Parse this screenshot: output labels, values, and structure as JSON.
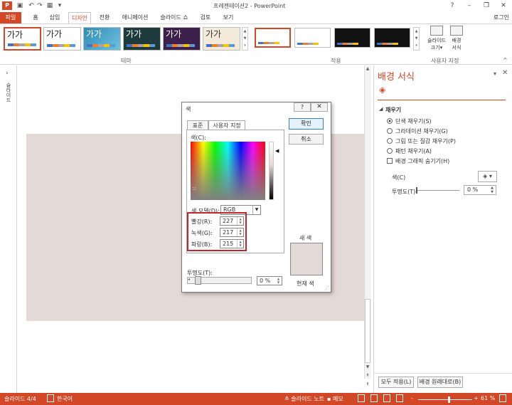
{
  "app": {
    "window_title": "프레젠테이션2 - PowerPoint",
    "logo": "P",
    "user": "로그인"
  },
  "quick_access": [
    "save-icon",
    "undo-icon",
    "redo-icon",
    "start-from-beginning-icon",
    "customize-icon"
  ],
  "window_controls": {
    "help": "?",
    "minimize": "–",
    "restore": "❐",
    "close": "✕"
  },
  "tabs": [
    "파일",
    "홈",
    "삽입",
    "디자인",
    "전환",
    "애니메이션",
    "슬라이드 쇼",
    "검토",
    "보기"
  ],
  "ribbon": {
    "theme_sample": "가가",
    "groups": {
      "themes": "테마",
      "variants": "적용",
      "customize": "사용자 지정"
    },
    "slide_size": "슬라이드\n크기",
    "slide_size_caret": "▾",
    "background_format": "배경\n서식",
    "gallery_scroll": [
      "▲",
      "▼",
      "▾"
    ],
    "collapse": "^"
  },
  "left_pane": {
    "label": "슬라이드",
    "expand": "›"
  },
  "scrollbar": {
    "up": "▲",
    "down": "▼",
    "prev": "⇞",
    "next": "⇟"
  },
  "format_pane": {
    "title": "배경 서식",
    "dropdown": "▾",
    "close": "✕",
    "section_caret": "◢",
    "section": "채우기",
    "options": [
      {
        "label": "단색 채우기(S)",
        "checked": true
      },
      {
        "label": "그라데이션 채우기(G)",
        "checked": false
      },
      {
        "label": "그림 또는 질감 채우기(P)",
        "checked": false
      },
      {
        "label": "패턴 채우기(A)",
        "checked": false
      }
    ],
    "hide_graphics": "배경 그래픽 숨기기(H)",
    "color_label": "색(C)",
    "color_button": "◈ ▾",
    "transparency_label": "투명도(T)",
    "transparency_value": "0 %",
    "transparency": 0,
    "apply_all": "모두 적용(L)",
    "reset": "배경 원래대로(B)"
  },
  "dialog": {
    "title": "색",
    "help": "?",
    "close": "✕",
    "tabs": [
      "표준",
      "사용자 지정"
    ],
    "colors_label": "색(C):",
    "model_label": "색 모델(D):",
    "model_value": "RGB",
    "model_arrow": "▼",
    "spectrum_cursor": "⁙",
    "luminance_arrow": "◀",
    "channels": [
      {
        "label": "빨강(R):",
        "value": "227"
      },
      {
        "label": "녹색(G):",
        "value": "217"
      },
      {
        "label": "파랑(B):",
        "value": "215"
      }
    ],
    "spin": "▲\n▼",
    "ok": "확인",
    "cancel": "취소",
    "new_label": "새 색",
    "current_label": "현재 색",
    "transparency_label": "투명도(T):",
    "transparency_value": "0 %",
    "transparency": 0,
    "slider_left": "◂",
    "grip": "⋰",
    "selected_color": "#e3d9d7"
  },
  "status": {
    "slide": "슬라이드 4/4",
    "language": "한국어",
    "notes": "슬라이드 노트",
    "comments": "메모",
    "zoom_minus": "-",
    "zoom_plus": "+",
    "zoom": "61 %",
    "zoom_fraction": 0.61
  },
  "colors": {
    "accent": "#d24726",
    "highlight": "#c0272d",
    "slide_bg": "#e3d9d7"
  }
}
